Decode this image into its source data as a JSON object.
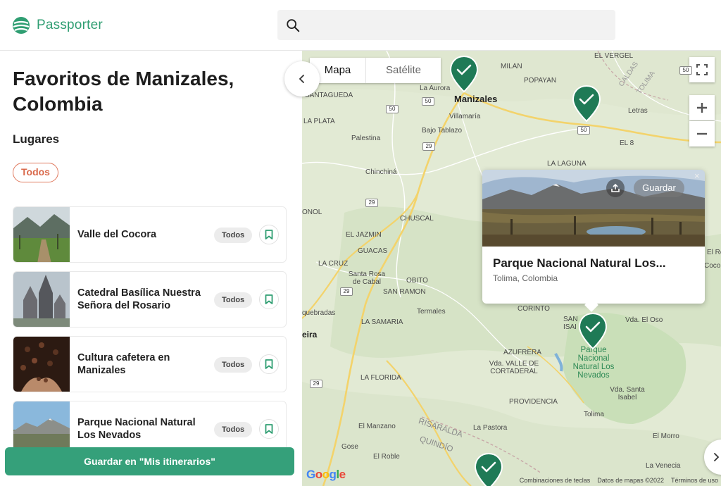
{
  "header": {
    "app_name": "Passporter",
    "brand_color": "#2f9e72",
    "search_icon": "search-icon"
  },
  "panel": {
    "title": "Favoritos de Manizales, Colombia",
    "section_label": "Lugares",
    "filter_chip": "Todos",
    "places": [
      {
        "name": "Valle del Cocora",
        "tag": "Todos"
      },
      {
        "name": "Catedral Basílica Nuestra Señora del Rosario",
        "tag": "Todos"
      },
      {
        "name": "Cultura cafetera en Manizales",
        "tag": "Todos"
      },
      {
        "name": "Parque Nacional Natural Los Nevados",
        "tag": "Todos"
      }
    ],
    "save_button": "Guardar en \"Mis itinerarios\""
  },
  "map": {
    "type_options": {
      "selected": "Mapa",
      "other": "Satélite"
    },
    "labels": {
      "manizales": "Manizales",
      "villamaria": "Villamaría",
      "la_aurora": "La Aurora",
      "bajo_tablazo": "Bajo Tablazo",
      "santagueda": "SANTAGUEDA",
      "la_plata": "LA PLATA",
      "palestina": "Palestina",
      "chinchina": "Chinchiná",
      "milan": "MILAN",
      "popayan": "POPAYAN",
      "el_vergel": "EL VERGEL",
      "caldas": "CALDAS",
      "tolima": "TOLIMA",
      "letras": "Letras",
      "el8": "EL 8",
      "la_laguna": "LA LAGUNA",
      "chuscal": "CHUSCAL",
      "el_jazmin": "EL JAZMIN",
      "guacas": "GUACAS",
      "la_cruz": "LA CRUZ",
      "santa_rosa": "Santa Rosa de Cabal",
      "obito": "OBITO",
      "san_ramon": "SAN RAMON",
      "termales": "Termales",
      "quebradas": "quebradas",
      "eira": "eira",
      "la_samaria": "LA SAMARIA",
      "corinto": "CORINTO",
      "san_isa": "SAN ISAI",
      "vda_el_oso": "Vda. El Oso",
      "azufrera": "AZUFRERA",
      "vda_valle": "Vda. VALLE DE CORTADERAL",
      "park": "Parque Nacional Natural Los Nevados",
      "la_florida": "LA FLORIDA",
      "vda_santa_isabel": "Vda. Santa Isabel",
      "providencia": "PROVIDENCIA",
      "tolima_town": "Tolima",
      "el_manzano": "El Manzano",
      "risaralda": "RISARALDA",
      "quindio": "QUINDÍO",
      "la_pastora": "La Pastora",
      "el_morro": "El Morro",
      "gose": "Gose",
      "el_roble": "El Roble",
      "la_venecia": "La Venecia",
      "onol": "ONOL",
      "el_re": "El Re",
      "coco": "Coco"
    },
    "road_shields": [
      "50",
      "50",
      "50",
      "29",
      "29",
      "29",
      "29",
      "50"
    ],
    "popup": {
      "title": "Parque Nacional Natural Los...",
      "subtitle": "Tolima, Colombia",
      "save_label": "Guardar",
      "close_glyph": "×"
    },
    "google_logo": "Google",
    "footer": {
      "shortcuts": "Combinaciones de teclas",
      "data": "Datos de mapas ©2022",
      "terms": "Términos de uso"
    },
    "marker_color": "#1f7a56"
  }
}
